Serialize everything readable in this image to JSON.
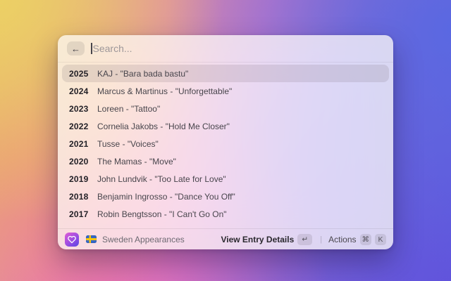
{
  "window": {
    "search": {
      "placeholder": "Search...",
      "back_icon": "←"
    },
    "list": [
      {
        "year": "2025",
        "title": "KAJ - \"Bara bada bastu\"",
        "selected": true
      },
      {
        "year": "2024",
        "title": "Marcus & Martinus - \"Unforgettable\"",
        "selected": false
      },
      {
        "year": "2023",
        "title": "Loreen - \"Tattoo\"",
        "selected": false
      },
      {
        "year": "2022",
        "title": "Cornelia Jakobs - \"Hold Me Closer\"",
        "selected": false
      },
      {
        "year": "2021",
        "title": "Tusse - \"Voices\"",
        "selected": false
      },
      {
        "year": "2020",
        "title": "The Mamas - \"Move\"",
        "selected": false
      },
      {
        "year": "2019",
        "title": "John Lundvik - \"Too Late for Love\"",
        "selected": false
      },
      {
        "year": "2018",
        "title": "Benjamin Ingrosso - \"Dance You Off\"",
        "selected": false
      },
      {
        "year": "2017",
        "title": "Robin Bengtsson - \"I Can't Go On\"",
        "selected": false
      }
    ],
    "footer": {
      "app_icon": "heart-icon",
      "flag_icon": "sweden-flag-icon",
      "source_label": "Sweden Appearances",
      "primary_action": "View Entry Details",
      "primary_key": "↵",
      "divider": "|",
      "secondary_action": "Actions",
      "secondary_key_1": "⌘",
      "secondary_key_2": "K"
    }
  },
  "colors": {
    "selection_highlight": "rgba(100,88,98,0.15)",
    "app_icon_gradient_start": "#e15cd4",
    "app_icon_gradient_end": "#5748e4",
    "flag_blue": "#3567c6",
    "flag_yellow": "#f6c70f",
    "bg_yellow": "#e7c06f",
    "bg_pink": "#eb69b9",
    "bg_blue": "#5569e4",
    "bg_purple": "#6250dc"
  }
}
